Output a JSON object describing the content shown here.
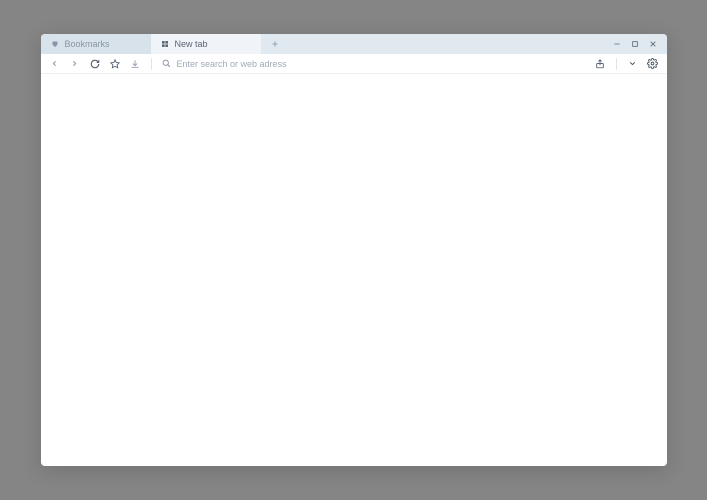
{
  "tabs": {
    "bookmarks": {
      "label": "Bookmarks",
      "icon": "heart-icon"
    },
    "newtab": {
      "label": "New tab",
      "icon": "grid-icon"
    }
  },
  "addressBar": {
    "placeholder": "Enter search or web adress"
  }
}
